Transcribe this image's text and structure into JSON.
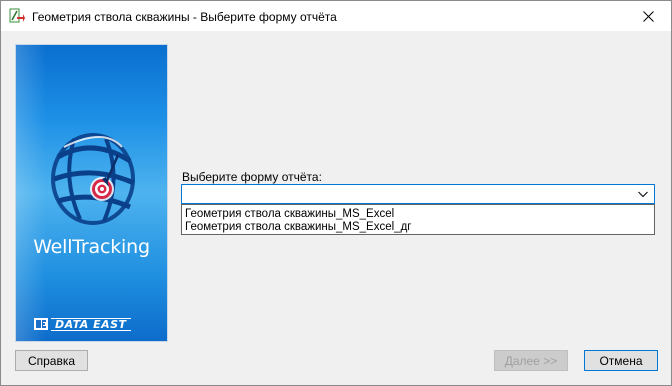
{
  "window": {
    "title": "Геометрия ствола скважины - Выберите форму отчёта",
    "icon": "app-icon",
    "close_icon": "close-icon"
  },
  "banner": {
    "product_name": "WellTracking",
    "vendor_name": "DATA EAST",
    "logo_icon": "globe-target-icon",
    "vendor_icon": "data-east-icon"
  },
  "form": {
    "prompt_label": "Выберите форму отчёта:",
    "selected_value": "",
    "options": [
      "Геометрия ствола скважины_MS_Excel",
      "Геометрия ствола скважины_MS_Excel_дг"
    ]
  },
  "buttons": {
    "help_label": "Справка",
    "next_label": "Далее >>",
    "next_enabled": false,
    "cancel_label": "Отмена"
  },
  "colors": {
    "focus_blue": "#0078d7",
    "banner_blue": "#1d90e6",
    "target_red": "#d8284a"
  }
}
